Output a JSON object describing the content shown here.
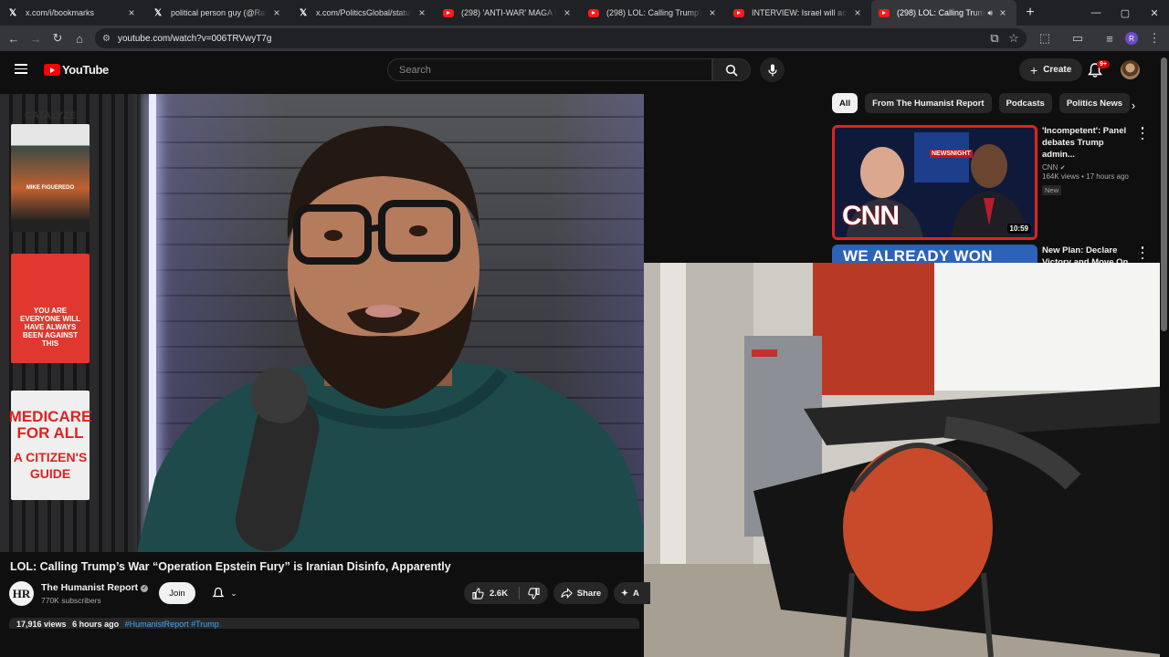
{
  "browser": {
    "tabs": [
      {
        "icon": "x-icon",
        "title": "x.com/i/bookmarks",
        "active": false
      },
      {
        "icon": "x-icon",
        "title": "political person guy (@RafaAn",
        "active": false
      },
      {
        "icon": "x-icon",
        "title": "x.com/PoliticsGlobal/status/20",
        "active": false
      },
      {
        "icon": "youtube-icon",
        "title": "(298) 'ANTI-WAR' MAGA Grifte",
        "active": false
      },
      {
        "icon": "youtube-icon",
        "title": "(298) LOL: Calling Trump's Wa",
        "active": false
      },
      {
        "icon": "youtube-icon",
        "title": "INTERVIEW: Israel will achieve",
        "active": false
      },
      {
        "icon": "youtube-icon",
        "title": "(298) LOL: Calling Trump's W",
        "active": true
      }
    ],
    "url": "youtube.com/watch?v=006TRVwyT7g",
    "profile_initial": "R"
  },
  "youtube": {
    "logo_text": "YouTube",
    "search_placeholder": "Search",
    "create_label": "Create",
    "notifications_badge": "9+"
  },
  "video": {
    "title": "LOL: Calling Trump’s War “Operation Epstein Fury” is Iranian Disinfo, Apparently",
    "channel_initials": "HR",
    "channel_name": "The Humanist Report",
    "subscribers": "770K subscribers",
    "join_label": "Join",
    "likes": "2.6K",
    "share_label": "Share",
    "ask_label": "A",
    "views": "17,916 views",
    "age": "6 hours ago",
    "hashtags": "#HumanistReport #Trump",
    "book_titles": [
      "CATALYZE",
      "MIKE FIGUEREDO",
      "YOU ARE EVERYONE WILL HAVE ALWAYS BEEN AGAINST THIS",
      "MEDICARE FOR ALL",
      "A CITIZEN'S GUIDE"
    ]
  },
  "sidebar": {
    "chips": [
      {
        "label": "All",
        "selected": true
      },
      {
        "label": "From The Humanist Report",
        "selected": false
      },
      {
        "label": "Podcasts",
        "selected": false
      },
      {
        "label": "Politics News",
        "selected": false
      }
    ],
    "recommendations": [
      {
        "title": "'Incompetent': Panel debates Trump admin...",
        "channel": "CNN",
        "views": "164K views",
        "age": "17 hours ago",
        "badge": "New",
        "duration": "10:59",
        "thumb_text_1": "CNN",
        "thumb_text_2": "NEWSNIGHT"
      },
      {
        "title": "New Plan: Declare Victory and Move On",
        "thumb_text": "WE ALREADY WON"
      }
    ]
  },
  "colors": {
    "youtube_red": "#ff0000",
    "background": "#0f0f0f",
    "chip_bg": "#272727",
    "link_blue": "#3ea6ff"
  }
}
